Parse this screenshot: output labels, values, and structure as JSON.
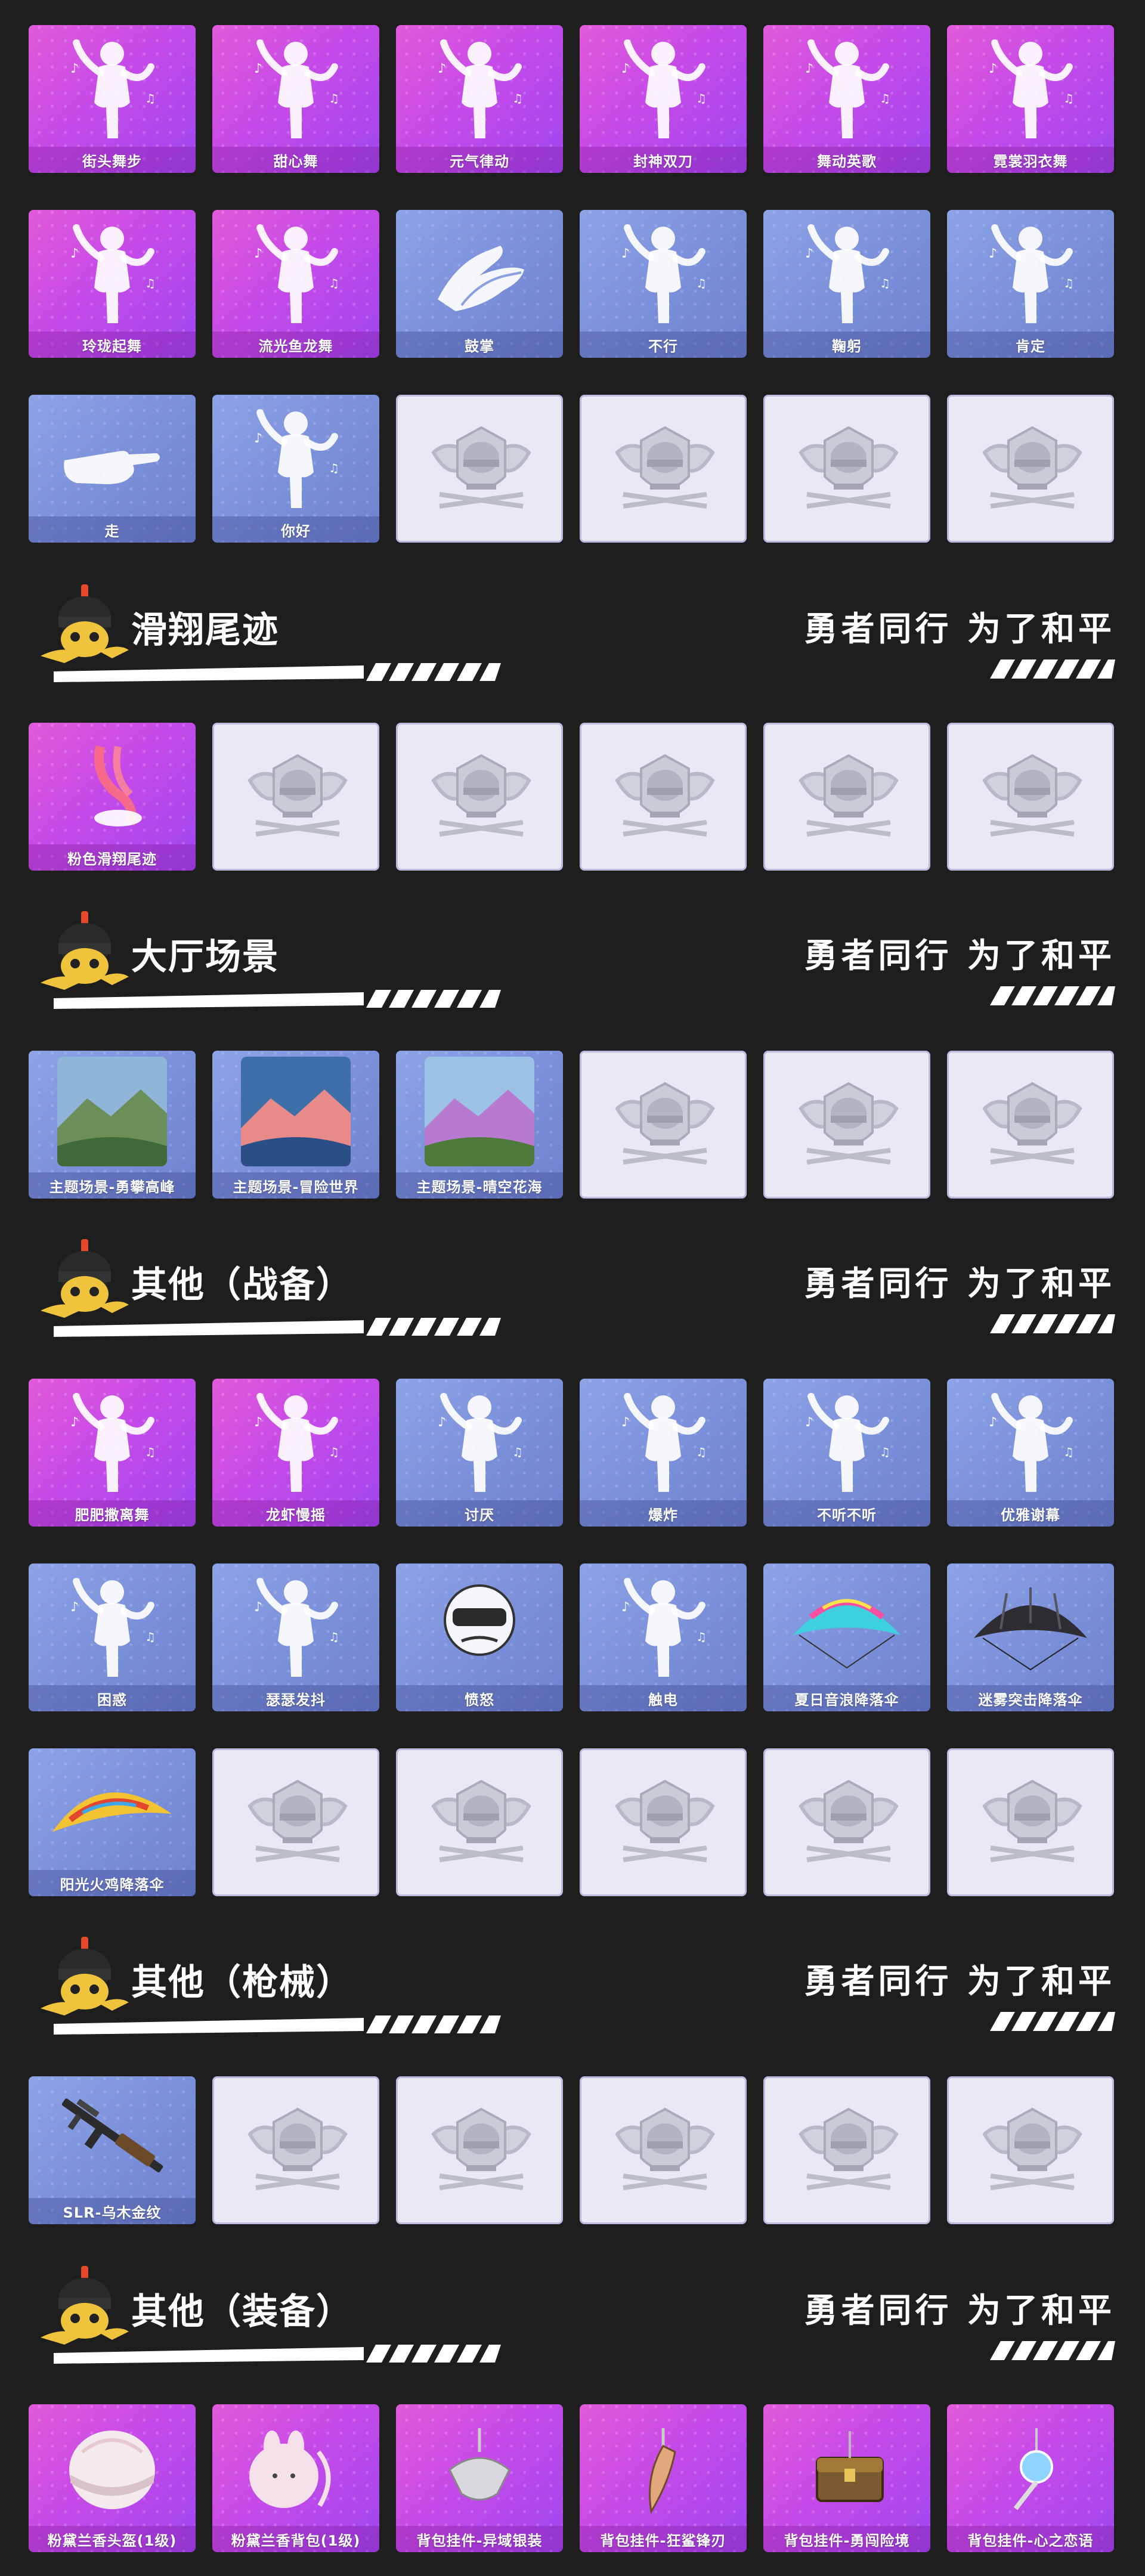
{
  "slogan": "勇者同行 为了和平",
  "colors": {
    "background": "#1e1e1f",
    "pink_card": "#d24fe3",
    "blue_card": "#7f93dc",
    "empty_card": "#e8e9f4"
  },
  "emotes_top": {
    "items": [
      {
        "label": "街头舞步",
        "style": "pink",
        "icon": "dancer-figure"
      },
      {
        "label": "甜心舞",
        "style": "pink",
        "icon": "dancer-figure"
      },
      {
        "label": "元气律动",
        "style": "pink",
        "icon": "dancer-figure"
      },
      {
        "label": "封神双刀",
        "style": "pink",
        "icon": "dancer-twin-blades"
      },
      {
        "label": "舞动英歌",
        "style": "pink",
        "icon": "dancer-bubble"
      },
      {
        "label": "霓裳羽衣舞",
        "style": "pink",
        "icon": "dancer-figure"
      },
      {
        "label": "玲珑起舞",
        "style": "pink",
        "icon": "dancer-figure"
      },
      {
        "label": "流光鱼龙舞",
        "style": "pink",
        "icon": "dancer-red-dragon"
      },
      {
        "label": "鼓掌",
        "style": "blue",
        "icon": "clapping-hands"
      },
      {
        "label": "不行",
        "style": "blue",
        "icon": "head-shake"
      },
      {
        "label": "鞠躬",
        "style": "blue",
        "icon": "bow-figure"
      },
      {
        "label": "肯定",
        "style": "blue",
        "icon": "head-nod"
      },
      {
        "label": "走",
        "style": "blue",
        "icon": "pointing-hand"
      },
      {
        "label": "你好",
        "style": "blue",
        "icon": "waving-figure"
      },
      {
        "label": "",
        "style": "empty",
        "icon": "emblem"
      },
      {
        "label": "",
        "style": "empty",
        "icon": "emblem"
      },
      {
        "label": "",
        "style": "empty",
        "icon": "emblem"
      },
      {
        "label": "",
        "style": "empty",
        "icon": "emblem"
      }
    ]
  },
  "sections": [
    {
      "title": "滑翔尾迹",
      "items": [
        {
          "label": "粉色滑翔尾迹",
          "style": "pink",
          "icon": "glide-trail"
        },
        {
          "label": "",
          "style": "empty",
          "icon": "emblem"
        },
        {
          "label": "",
          "style": "empty",
          "icon": "emblem"
        },
        {
          "label": "",
          "style": "empty",
          "icon": "emblem"
        },
        {
          "label": "",
          "style": "empty",
          "icon": "emblem"
        },
        {
          "label": "",
          "style": "empty",
          "icon": "emblem"
        }
      ]
    },
    {
      "title": "大厅场景",
      "items": [
        {
          "label": "主题场景-勇攀高峰",
          "style": "blue",
          "icon": "scene-mountain"
        },
        {
          "label": "主题场景-冒险世界",
          "style": "blue",
          "icon": "scene-sea"
        },
        {
          "label": "主题场景-晴空花海",
          "style": "blue",
          "icon": "scene-flowers"
        },
        {
          "label": "",
          "style": "empty",
          "icon": "emblem"
        },
        {
          "label": "",
          "style": "empty",
          "icon": "emblem"
        },
        {
          "label": "",
          "style": "empty",
          "icon": "emblem"
        }
      ]
    },
    {
      "title": "其他（战备）",
      "items": [
        {
          "label": "肥肥撒离舞",
          "style": "pink",
          "icon": "dancer-fireworks"
        },
        {
          "label": "龙虾慢摇",
          "style": "pink",
          "icon": "dancer-figure"
        },
        {
          "label": "讨厌",
          "style": "blue",
          "icon": "facepalm-figure"
        },
        {
          "label": "爆炸",
          "style": "blue",
          "icon": "explode-figure"
        },
        {
          "label": "不听不听",
          "style": "blue",
          "icon": "covering-ears-figure"
        },
        {
          "label": "优雅谢幕",
          "style": "blue",
          "icon": "bow-figure"
        },
        {
          "label": "困惑",
          "style": "blue",
          "icon": "confused-figure"
        },
        {
          "label": "瑟瑟发抖",
          "style": "blue",
          "icon": "shivering-figure"
        },
        {
          "label": "愤怒",
          "style": "blue",
          "icon": "angry-helmet"
        },
        {
          "label": "触电",
          "style": "blue",
          "icon": "electrocuted-figure"
        },
        {
          "label": "夏日音浪降落伞",
          "style": "blue",
          "icon": "parachute-colorful"
        },
        {
          "label": "迷雾突击降落伞",
          "style": "blue",
          "icon": "parachute-dark"
        },
        {
          "label": "阳光火鸡降落伞",
          "style": "blue",
          "icon": "parachute-yellow"
        },
        {
          "label": "",
          "style": "empty",
          "icon": "emblem"
        },
        {
          "label": "",
          "style": "empty",
          "icon": "emblem"
        },
        {
          "label": "",
          "style": "empty",
          "icon": "emblem"
        },
        {
          "label": "",
          "style": "empty",
          "icon": "emblem"
        },
        {
          "label": "",
          "style": "empty",
          "icon": "emblem"
        }
      ]
    },
    {
      "title": "其他（枪械）",
      "items": [
        {
          "label": "SLR-乌木金纹",
          "style": "blue",
          "icon": "rifle"
        },
        {
          "label": "",
          "style": "empty",
          "icon": "emblem"
        },
        {
          "label": "",
          "style": "empty",
          "icon": "emblem"
        },
        {
          "label": "",
          "style": "empty",
          "icon": "emblem"
        },
        {
          "label": "",
          "style": "empty",
          "icon": "emblem"
        },
        {
          "label": "",
          "style": "empty",
          "icon": "emblem"
        }
      ]
    },
    {
      "title": "其他（装备）",
      "items": [
        {
          "label": "粉黛兰香头盔(1级)",
          "style": "pink",
          "icon": "helmet"
        },
        {
          "label": "粉黛兰香背包(1级)",
          "style": "pink",
          "icon": "backpack"
        },
        {
          "label": "背包挂件-异域银装",
          "style": "pink",
          "icon": "charm-silver"
        },
        {
          "label": "背包挂件-狂鲨锋刃",
          "style": "pink",
          "icon": "charm-shark"
        },
        {
          "label": "背包挂件-勇闯险境",
          "style": "pink",
          "icon": "charm-chest"
        },
        {
          "label": "背包挂件-心之恋语",
          "style": "pink",
          "icon": "charm-heart"
        }
      ]
    }
  ]
}
